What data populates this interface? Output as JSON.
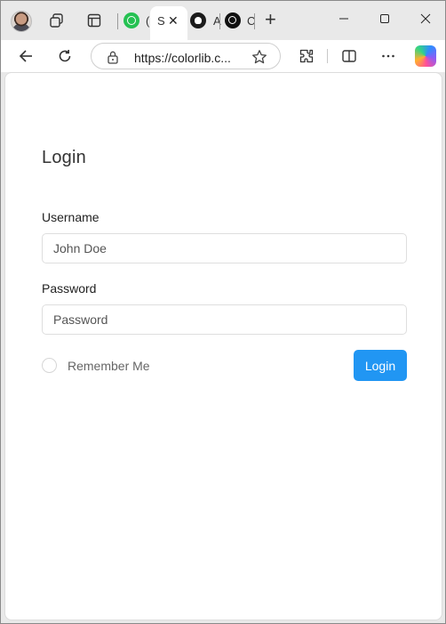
{
  "browser": {
    "tabs": [
      {
        "title_fragment": "(S",
        "favicon": "whatsapp-icon"
      },
      {
        "title_fragment": "S",
        "favicon": "blank-icon",
        "active": true
      },
      {
        "title_fragment": "A",
        "favicon": "github-icon"
      },
      {
        "title_fragment": "C",
        "favicon": "openai-icon"
      }
    ],
    "close_glyph": "✕",
    "new_tab_glyph": "+",
    "window_controls": {
      "minimize": "—",
      "maximize": "▢",
      "close": "✕"
    },
    "url": "https://colorlib.c...",
    "icons": [
      "back-icon",
      "refresh-icon",
      "lock-icon",
      "favorite-star-icon",
      "extensions-icon",
      "split-screen-icon",
      "more-icon",
      "copilot-icon"
    ]
  },
  "login_form": {
    "title": "Login",
    "username_label": "Username",
    "username_placeholder": "John Doe",
    "password_label": "Password",
    "password_placeholder": "Password",
    "remember_label": "Remember Me",
    "submit_label": "Login",
    "accent_color": "#2196f3"
  }
}
